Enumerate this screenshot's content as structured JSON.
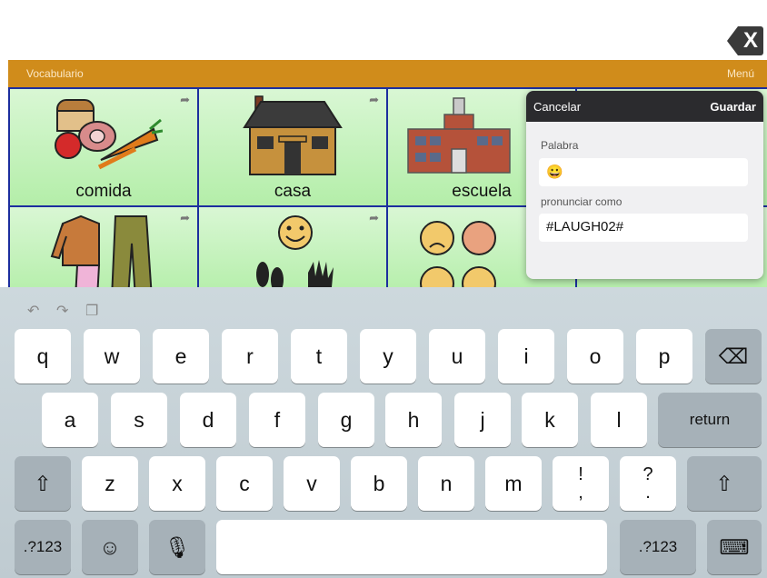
{
  "close_button": {
    "label": "X"
  },
  "header": {
    "title": "Vocabulario",
    "menu_label": "Menú"
  },
  "cells": [
    {
      "word": "comida"
    },
    {
      "word": "casa"
    },
    {
      "word": "escuela"
    }
  ],
  "popover": {
    "cancel_label": "Cancelar",
    "save_label": "Guardar",
    "word_label": "Palabra",
    "word_value": "😀",
    "pronounce_label": "pronunciar como",
    "pronounce_value": "#LAUGH02#"
  },
  "keyboard": {
    "row1": [
      "q",
      "w",
      "e",
      "r",
      "t",
      "y",
      "u",
      "i",
      "o",
      "p"
    ],
    "row2": [
      "a",
      "s",
      "d",
      "f",
      "g",
      "h",
      "j",
      "k",
      "l"
    ],
    "row3": [
      "z",
      "x",
      "c",
      "v",
      "b",
      "n",
      "m"
    ],
    "punct1": {
      "top": "!",
      "bottom": ","
    },
    "punct2": {
      "top": "?",
      "bottom": "."
    },
    "return_label": "return",
    "numbers_label": ".?123",
    "icons": {
      "undo": "undo-icon",
      "redo": "redo-icon",
      "paste": "paste-icon",
      "backspace": "backspace-icon",
      "shift": "shift-icon",
      "emoji": "emoji-icon",
      "mic": "microphone-icon",
      "hide": "keyboard-hide-icon"
    }
  },
  "colors": {
    "header": "#d08c1b",
    "grid_border": "#1c2e9e",
    "cell_green": "#b4eea9",
    "popover_head": "#2b2b2e"
  }
}
